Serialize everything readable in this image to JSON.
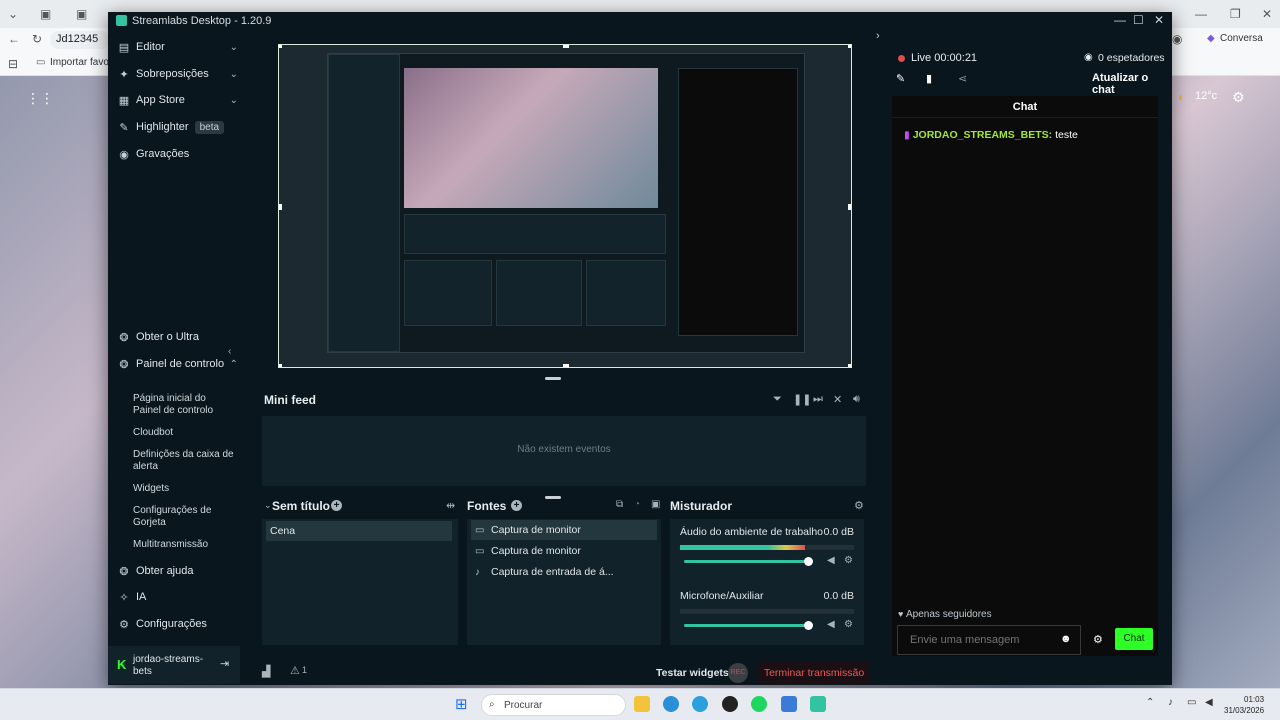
{
  "browser": {
    "address": "Jd12345",
    "favorites_item": "Importar favorit",
    "copilot_label": "Conversa",
    "weather": "12°c"
  },
  "app": {
    "title": "Streamlabs Desktop - 1.20.9"
  },
  "sidebar": {
    "items": [
      {
        "label": "Editor",
        "icon": "editor-icon"
      },
      {
        "label": "Sobreposições",
        "icon": "overlays-icon"
      },
      {
        "label": "App Store",
        "icon": "store-icon"
      },
      {
        "label": "Highlighter",
        "icon": "highlighter-icon",
        "badge": "beta"
      },
      {
        "label": "Gravações",
        "icon": "recordings-icon"
      }
    ],
    "ultra": "Obter o Ultra",
    "dashboard": "Painel de controlo",
    "dashboard_subitems": [
      "Página inicial do Painel de controlo",
      "Cloudbot",
      "Definições da caixa de alerta",
      "Widgets",
      "Configurações de Gorjeta",
      "Multitransmissão"
    ],
    "help": "Obter ajuda",
    "ai": "IA",
    "settings": "Configurações",
    "user": "jordao-streams-bets"
  },
  "minifeed": {
    "title": "Mini feed",
    "empty": "Não existem eventos"
  },
  "scenes": {
    "title": "Sem título",
    "items": [
      "Cena"
    ]
  },
  "sources": {
    "title": "Fontes",
    "items": [
      {
        "label": "Captura de monitor",
        "icon": "monitor-icon"
      },
      {
        "label": "Captura de monitor",
        "icon": "monitor-icon"
      },
      {
        "label": "Captura de entrada de á...",
        "icon": "microphone-icon"
      }
    ]
  },
  "mixer": {
    "title": "Misturador",
    "channels": [
      {
        "name": "Áudio do ambiente de trabalho",
        "db": "0.0 dB",
        "level": 0.72
      },
      {
        "name": "Microfone/Auxiliar",
        "db": "0.0 dB",
        "level": 0.0
      }
    ]
  },
  "footer": {
    "test_widgets": "Testar widgets",
    "rec": "REC",
    "end_stream": "Terminar transmissão",
    "alerts_count": "1"
  },
  "chat_panel": {
    "live": "Live 00:00:21",
    "viewers": "0 espetadores",
    "refresh": "Atualizar o chat",
    "header": "Chat",
    "message_user": "JORDAO_STREAMS_BETS",
    "message_text": "teste",
    "followers_only": "Apenas seguidores",
    "input_placeholder": "Envie uma mensagem",
    "send": "Chat"
  },
  "taskbar": {
    "search_placeholder": "Procurar",
    "time": "01:03",
    "date": "31/03/2026"
  },
  "colors": {
    "accent": "#31c3a2",
    "chat_send": "#2dff26",
    "danger": "#e85b5b"
  }
}
